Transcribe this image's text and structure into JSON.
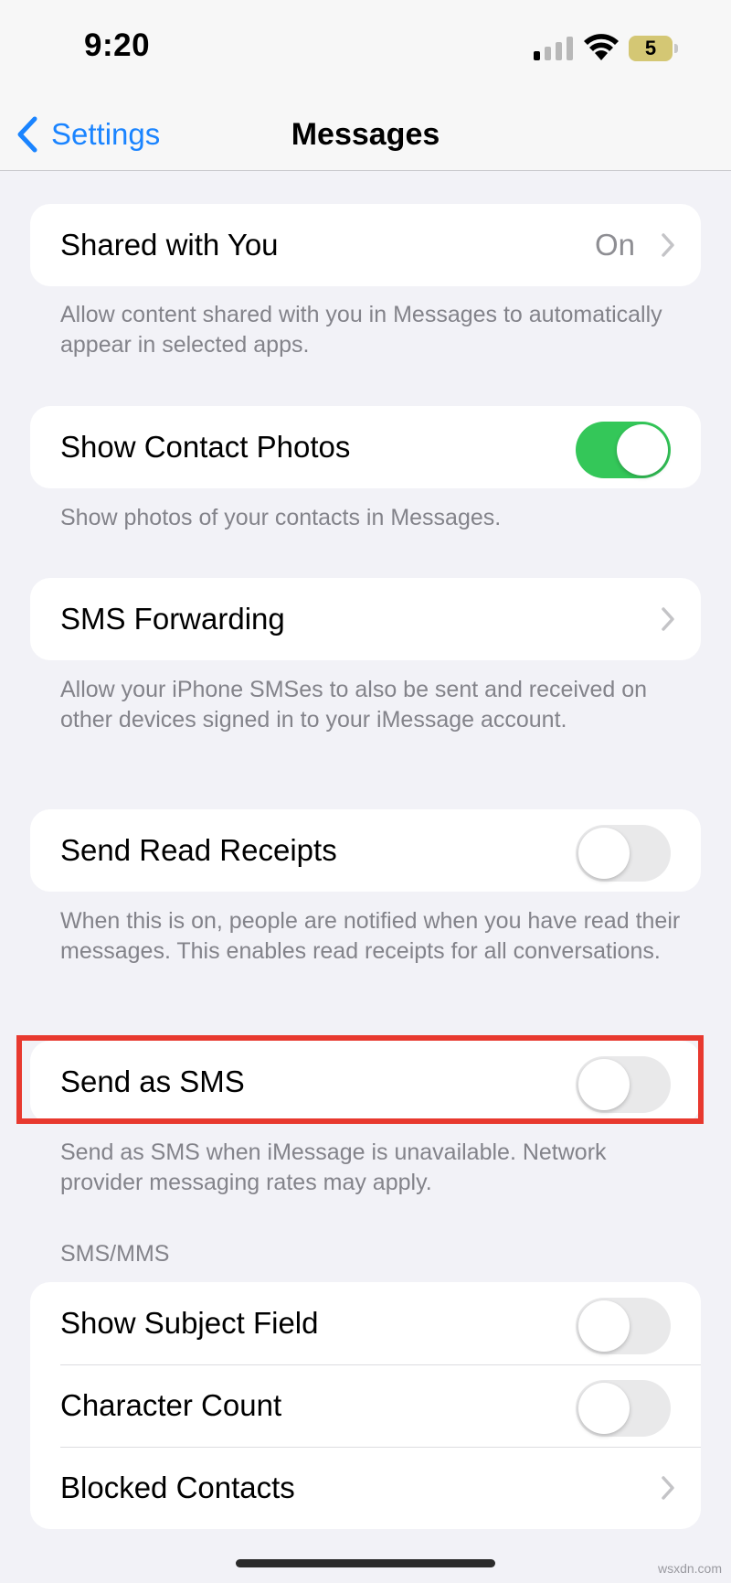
{
  "status_bar": {
    "time": "9:20",
    "battery_level": "5",
    "signal_bars_active": 1,
    "signal_bars_total": 4
  },
  "nav": {
    "back_label": "Settings",
    "title": "Messages"
  },
  "settings": {
    "shared_with_you": {
      "label": "Shared with You",
      "value": "On",
      "footer": "Allow content shared with you in Messages to automatically appear in selected apps."
    },
    "show_contact_photos": {
      "label": "Show Contact Photos",
      "on": true,
      "footer": "Show photos of your contacts in Messages."
    },
    "sms_forwarding": {
      "label": "SMS Forwarding",
      "footer": "Allow your iPhone SMSes to also be sent and received on other devices signed in to your iMessage account."
    },
    "send_read_receipts": {
      "label": "Send Read Receipts",
      "on": false,
      "footer": "When this is on, people are notified when you have read their messages. This enables read receipts for all conversations."
    },
    "send_as_sms": {
      "label": "Send as SMS",
      "on": false,
      "footer": "Send as SMS when iMessage is unavailable. Network provider messaging rates may apply."
    },
    "sms_mms": {
      "header": "SMS/MMS",
      "show_subject_field": {
        "label": "Show Subject Field",
        "on": false
      },
      "character_count": {
        "label": "Character Count",
        "on": false
      },
      "blocked_contacts": {
        "label": "Blocked Contacts"
      }
    }
  },
  "watermark": "wsxdn.com",
  "colors": {
    "accent": "#1a84ff",
    "toggle_on": "#34c759",
    "highlight_box": "#e8392f",
    "background": "#f2f2f7"
  },
  "icons": [
    "chevron-left-icon",
    "chevron-right-icon",
    "cellular-signal-icon",
    "wifi-icon",
    "battery-icon"
  ]
}
